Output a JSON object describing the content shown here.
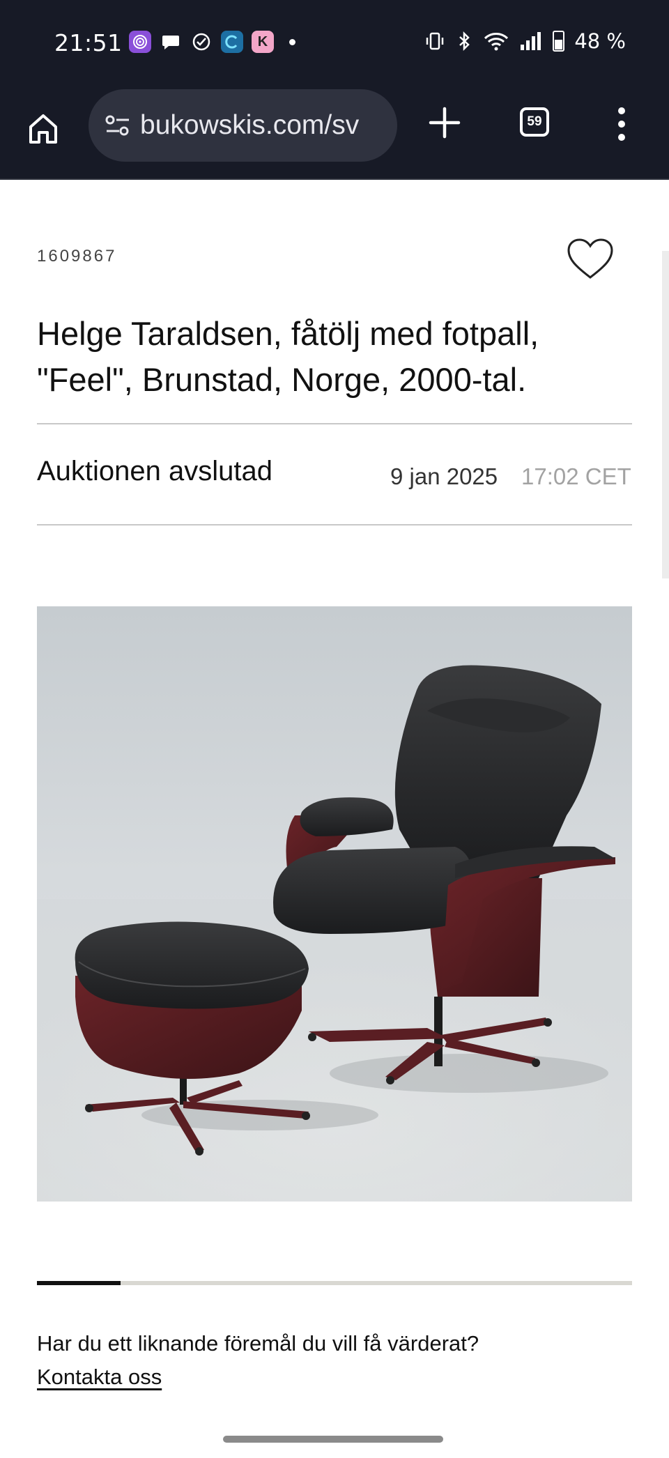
{
  "status_bar": {
    "time": "21:51",
    "battery_text": "48 %",
    "app_icons": [
      "podcast-app-icon",
      "chat-icon",
      "check-circle-icon",
      "browser-app-icon",
      "k-app-icon"
    ],
    "k_app_letter": "K",
    "system_icons": [
      "vibrate-icon",
      "bluetooth-icon",
      "wifi-icon",
      "signal-icon",
      "battery-icon"
    ]
  },
  "browser": {
    "url": "bukowskis.com/sv",
    "tab_count": "59",
    "colors": {
      "toolbar_bg": "#171a26",
      "url_bg": "#2f323f"
    }
  },
  "lot": {
    "number": "1609867",
    "title": "Helge Taraldsen, fåtölj med fotpall, \"Feel\", Brunstad, Norge, 2000-tal.",
    "auction_status": "Auktionen avslutad",
    "date": "9 jan 2025",
    "time": "17:02 CET"
  },
  "gallery": {
    "progress_fraction": 0.14
  },
  "contact": {
    "question": "Har du ett liknande föremål du vill få värderat?",
    "link_label": "Kontakta oss"
  }
}
